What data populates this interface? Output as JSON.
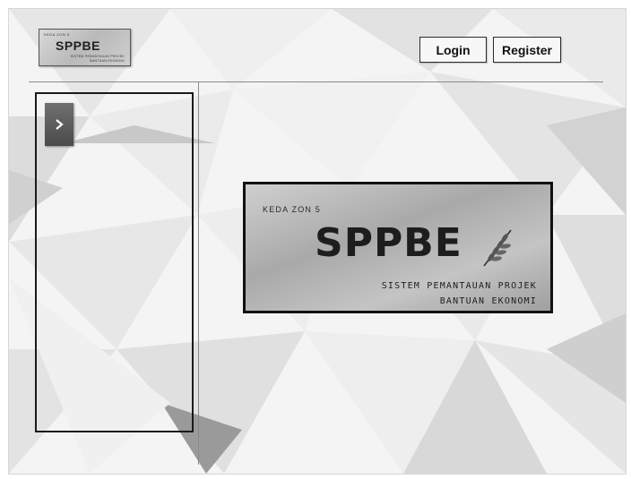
{
  "header": {
    "logo": {
      "top_text": "KEDA ZON 5",
      "title": "SPPBE",
      "subtitle_line1": "SISTEM PEMANTAUAN PROJEK",
      "subtitle_line2": "BANTUAN EKONOMI"
    },
    "login_label": "Login",
    "register_label": "Register"
  },
  "sidebar": {
    "toggle_icon": "chevron-right-icon",
    "toggle_glyph": ">"
  },
  "banner": {
    "top_text": "KEDA ZON 5",
    "title": "SPPBE",
    "subtitle_line1": "SISTEM PEMANTAUAN PROJEK",
    "subtitle_line2": "BANTUAN EKONOMI",
    "icon": "wheat-leaf-icon"
  },
  "colors": {
    "background": "#f4f4f4",
    "border_dark": "#1a1a1a",
    "toggle_bg": "#5a5a5a"
  }
}
